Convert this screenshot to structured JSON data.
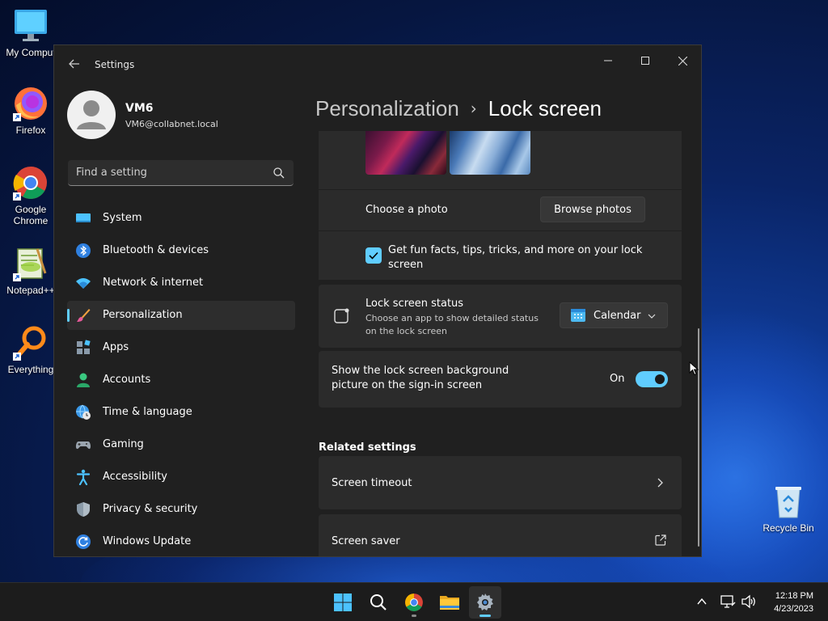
{
  "desktop": {
    "icons": [
      {
        "label": "My Comput"
      },
      {
        "label": "Firefox"
      },
      {
        "label": "Google Chrome"
      },
      {
        "label": "Notepad++"
      },
      {
        "label": "Everything"
      },
      {
        "label": "Recycle Bin"
      }
    ]
  },
  "window": {
    "title": "Settings"
  },
  "profile": {
    "name": "VM6",
    "email": "VM6@collabnet.local"
  },
  "search": {
    "placeholder": "Find a setting"
  },
  "nav": {
    "items": [
      {
        "label": "System",
        "icon": "monitor-icon"
      },
      {
        "label": "Bluetooth & devices",
        "icon": "bluetooth-icon"
      },
      {
        "label": "Network & internet",
        "icon": "wifi-icon"
      },
      {
        "label": "Personalization",
        "icon": "brush-icon",
        "active": true
      },
      {
        "label": "Apps",
        "icon": "apps-icon"
      },
      {
        "label": "Accounts",
        "icon": "person-icon"
      },
      {
        "label": "Time & language",
        "icon": "globe-clock-icon"
      },
      {
        "label": "Gaming",
        "icon": "gamepad-icon"
      },
      {
        "label": "Accessibility",
        "icon": "accessibility-icon"
      },
      {
        "label": "Privacy & security",
        "icon": "shield-icon"
      },
      {
        "label": "Windows Update",
        "icon": "update-icon"
      }
    ]
  },
  "breadcrumb": {
    "parent": "Personalization",
    "separator": "›",
    "current": "Lock screen"
  },
  "content": {
    "choose_photo_label": "Choose a photo",
    "browse_photos_label": "Browse photos",
    "fun_facts_label": "Get fun facts, tips, tricks, and more on your lock screen",
    "fun_facts_checked": true,
    "status_title": "Lock screen status",
    "status_desc": "Choose an app to show detailed status on the lock screen",
    "status_app": "Calendar",
    "signin_bg_label": "Show the lock screen background picture on the sign-in screen",
    "signin_bg_state": "On",
    "related_heading": "Related settings",
    "screen_timeout_label": "Screen timeout",
    "screen_saver_label": "Screen saver"
  },
  "taskbar": {
    "time": "12:18 PM",
    "date": "4/23/2023"
  },
  "colors": {
    "accent": "#60cdff",
    "window_bg": "#202020",
    "card_bg": "#2b2b2b"
  }
}
